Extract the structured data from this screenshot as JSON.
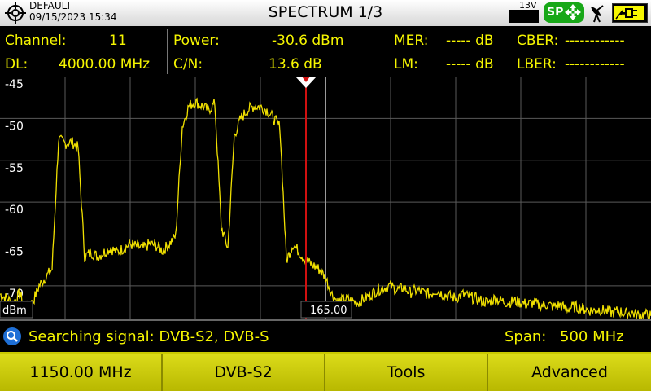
{
  "header": {
    "profile": "DEFAULT",
    "datetime": "09/15/2023 15:34",
    "title": "SPECTRUM 1/3",
    "voltage": "13V",
    "sp_label": "SP"
  },
  "measurements": {
    "channel": {
      "label": "Channel:",
      "value": "11"
    },
    "dl": {
      "label": "DL:",
      "value": "4000.00 MHz"
    },
    "power": {
      "label": "Power:",
      "value": "-30.6 dBm"
    },
    "cn": {
      "label": "C/N:",
      "value": "13.6 dB"
    },
    "mer": {
      "label": "MER:",
      "value": "----- dB"
    },
    "lm": {
      "label": "LM:",
      "value": "----- dB"
    },
    "cber": {
      "label": "CBER:",
      "value": "------------"
    },
    "lber": {
      "label": "LBER:",
      "value": "------------"
    }
  },
  "chart_data": {
    "type": "line",
    "ylabel": "dBm",
    "y_tick_labels": [
      "-45",
      "-50",
      "-55",
      "-60",
      "-65",
      "-70"
    ],
    "ylim": [
      -74,
      -45
    ],
    "xlim": [
      0,
      100
    ],
    "grid": true,
    "marker_readout": "165.00",
    "marker_position_fraction": 0.47,
    "series": [
      {
        "color": "#f0e000",
        "x": [
          0,
          1,
          2,
          3,
          4,
          5,
          6,
          7,
          8,
          9,
          10,
          11,
          12,
          13,
          14,
          15,
          16,
          17,
          18,
          19,
          20,
          21,
          22,
          23,
          24,
          25,
          26,
          27,
          28,
          29,
          30,
          31,
          32,
          33,
          34,
          35,
          36,
          37,
          38,
          39,
          40,
          41,
          42,
          43,
          44,
          45,
          46,
          47,
          48,
          49,
          50,
          51,
          52,
          53,
          54,
          55,
          56,
          57,
          58,
          59,
          60,
          61,
          62,
          63,
          64,
          65,
          66,
          67,
          68,
          69,
          70,
          71,
          72,
          73,
          74,
          75,
          76,
          77,
          78,
          79,
          80,
          81,
          82,
          83,
          84,
          85,
          86,
          87,
          88,
          89,
          90,
          91,
          92,
          93,
          94,
          95,
          96,
          97,
          98,
          99,
          100
        ],
        "y": [
          -71,
          -71.5,
          -72,
          -71,
          -72.5,
          -72,
          -70,
          -69,
          -68,
          -52.5,
          -53,
          -52.8,
          -53.5,
          -66.5,
          -66,
          -66.5,
          -66,
          -65.5,
          -66,
          -65.5,
          -65,
          -65.3,
          -65.5,
          -65,
          -65.2,
          -65.8,
          -65,
          -64,
          -51,
          -48.5,
          -48,
          -48.5,
          -49,
          -48.2,
          -63,
          -65.5,
          -52,
          -50,
          -49,
          -48.5,
          -48.6,
          -49,
          -50,
          -51,
          -67,
          -65,
          -66,
          -67,
          -67.5,
          -68,
          -69,
          -71,
          -72,
          -71.5,
          -71.8,
          -72,
          -71.5,
          -71,
          -70.5,
          -70.2,
          -70,
          -70.5,
          -70.2,
          -70.8,
          -70.5,
          -70.8,
          -71,
          -70.5,
          -71,
          -71.2,
          -71.5,
          -71,
          -71.3,
          -71.5,
          -71.8,
          -72,
          -71.5,
          -71.8,
          -72,
          -71.8,
          -72,
          -72.2,
          -72,
          -72.4,
          -72.2,
          -72.5,
          -72.3,
          -72.8,
          -72.5,
          -72.6,
          -72.8,
          -73,
          -72.8,
          -73,
          -73.2,
          -73,
          -73.3,
          -73.2,
          -73.5,
          -73.4,
          -73.6
        ]
      }
    ]
  },
  "status": {
    "search_text": "Searching signal: DVB-S2, DVB-S",
    "span_label": "Span:",
    "span_value": "500 MHz"
  },
  "softkeys": [
    "1150.00 MHz",
    "DVB-S2",
    "Tools",
    "Advanced"
  ]
}
